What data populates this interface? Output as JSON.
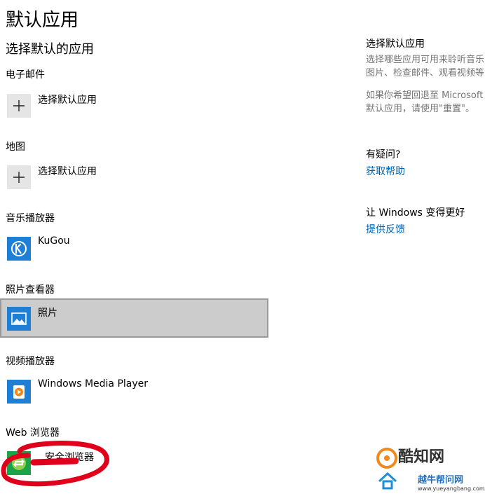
{
  "page": {
    "title": "默认应用",
    "section_title": "选择默认的应用"
  },
  "categories": [
    {
      "label": "电子邮件",
      "app": "选择默认应用",
      "icon": "plus-icon"
    },
    {
      "label": "地图",
      "app": "选择默认应用",
      "icon": "plus-icon"
    },
    {
      "label": "音乐播放器",
      "app": "KuGou",
      "icon": "kugou-icon"
    },
    {
      "label": "照片查看器",
      "app": "照片",
      "icon": "photos-icon",
      "selected": true
    },
    {
      "label": "视频播放器",
      "app": "Windows Media Player",
      "icon": "wmp-icon"
    },
    {
      "label": "Web 浏览器",
      "app": "安全浏览器",
      "icon": "browser-icon"
    }
  ],
  "side": {
    "heading": "选择默认应用",
    "desc_line1": "选择哪些应用可用来聆听音乐",
    "desc_line2": "图片、检查邮件、观看视频等",
    "reset_line1": "如果你希望回退至 Microsoft 推",
    "reset_line2": "默认应用，请使用\"重置\"。",
    "question": "有疑问?",
    "help_link": "获取帮助",
    "improve": "让 Windows 变得更好",
    "feedback_link": "提供反馈"
  },
  "watermark": {
    "brand": "酷知网",
    "site": "越牛帮问网",
    "url": "www.yueyangbang.com"
  },
  "colors": {
    "link": "#0063b1",
    "selected_bg": "#cccccc",
    "accent_blue": "#1e7fd4",
    "annotation_red": "#e0001b"
  }
}
